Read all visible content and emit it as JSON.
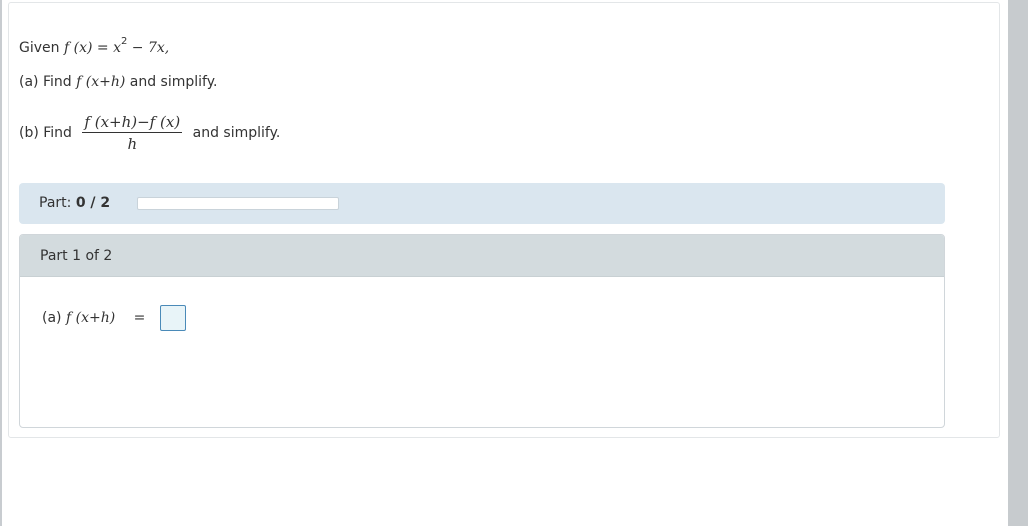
{
  "problem": {
    "given_prefix": "Given",
    "given_expr_lhs": "f (x)",
    "given_expr_eq": "=",
    "given_expr_x": "x",
    "given_expr_exp": "2",
    "given_expr_rest": "− 7x,",
    "part_a_prefix": "(a) Find",
    "part_a_expr": "f (x+h)",
    "part_a_suffix": "and simplify.",
    "part_b_prefix": "(b) Find",
    "part_b_numerator": "f (x+h)−f (x)",
    "part_b_denominator": "h",
    "part_b_suffix": "and simplify."
  },
  "progress": {
    "label": "Part:",
    "value": "0 / 2",
    "fraction_complete": 0
  },
  "part_panel": {
    "title": "Part 1 of 2",
    "answer_prefix": "(a)",
    "answer_expr": "f (x+h)",
    "equals": "="
  }
}
